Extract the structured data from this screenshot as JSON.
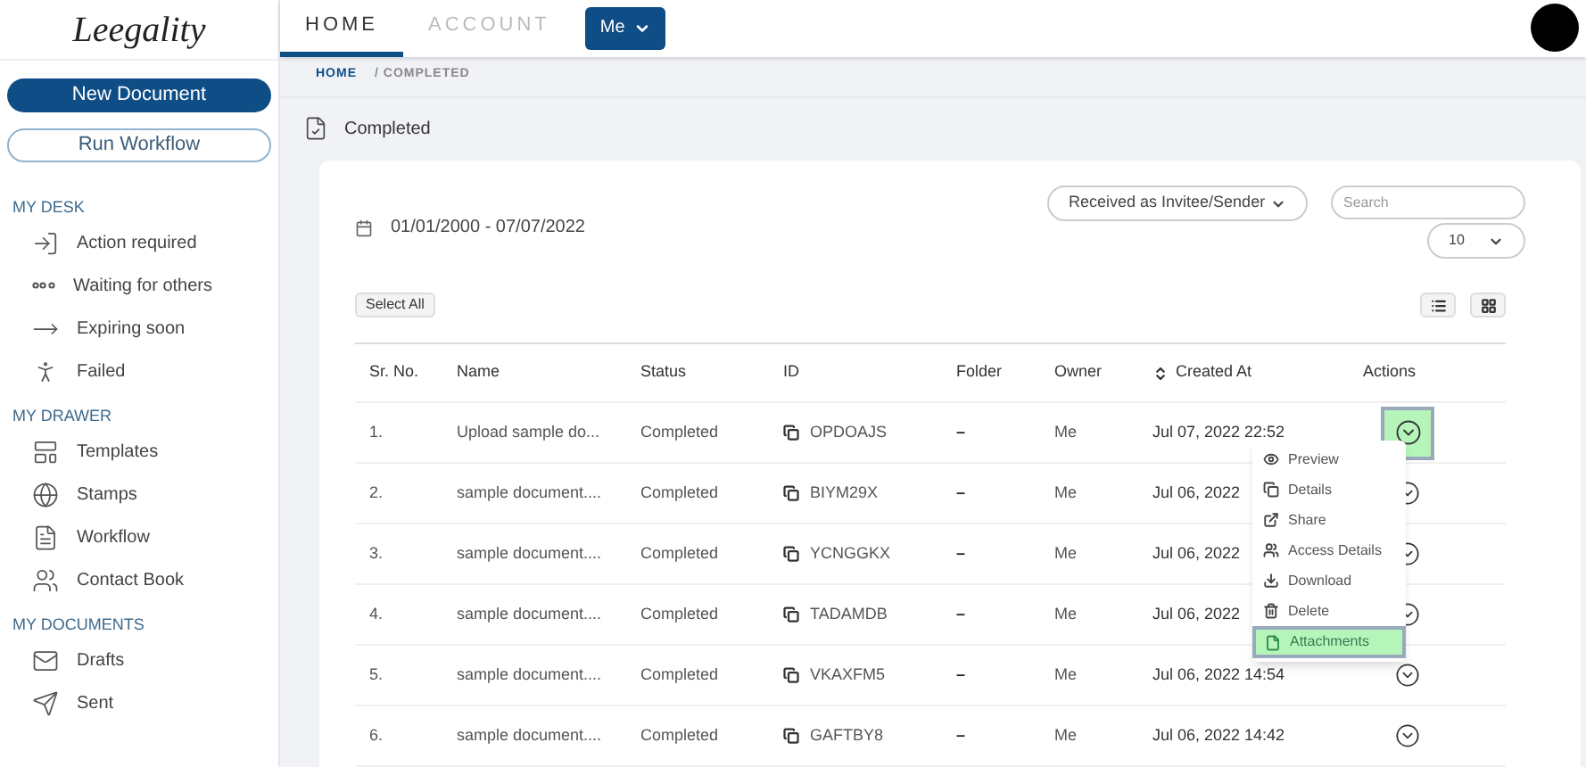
{
  "logo": {
    "text": "Leegality"
  },
  "sidebar": {
    "buttons": [
      {
        "label": "New Document",
        "kind": "primary"
      },
      {
        "label": "Run Workflow",
        "kind": "outline"
      }
    ],
    "sections": [
      {
        "title": "MY DESK",
        "items": [
          {
            "label": "Action required",
            "kind": "action"
          },
          {
            "label": "Waiting for others",
            "kind": "waiting"
          },
          {
            "label": "Expiring soon",
            "kind": "expiring"
          },
          {
            "label": "Failed",
            "kind": "failed"
          }
        ]
      },
      {
        "title": "MY DRAWER",
        "items": [
          {
            "label": "Templates",
            "kind": "templates"
          },
          {
            "label": "Stamps",
            "kind": "stamps"
          },
          {
            "label": "Workflow",
            "kind": "workflow"
          },
          {
            "label": "Contact Book",
            "kind": "contacts"
          }
        ]
      },
      {
        "title": "MY DOCUMENTS",
        "items": [
          {
            "label": "Drafts",
            "kind": "drafts"
          },
          {
            "label": "Sent",
            "kind": "sent"
          }
        ]
      }
    ]
  },
  "tabs": [
    {
      "label": "HOME",
      "selected": true
    },
    {
      "label": "ACCOUNT",
      "selected": false
    }
  ],
  "user_menu": {
    "label": "Me"
  },
  "breadcrumb": [
    {
      "label": "HOME",
      "selected": false
    },
    {
      "label": "/ COMPLETED",
      "selected": true
    }
  ],
  "page_title": "Completed",
  "filters": {
    "date_range": "01/01/2000 - 07/07/2022",
    "view_select": "Received as Invitee/Sender",
    "search": {
      "placeholder": "Search"
    },
    "page_size": "10",
    "select_all": "Select All"
  },
  "table": {
    "columns": [
      "Sr. No.",
      "Name",
      "Status",
      "ID",
      "Folder",
      "Owner",
      "Created At",
      "Actions"
    ],
    "rows": [
      {
        "sr": "1.",
        "name": "Upload sample do...",
        "status": "Completed",
        "id": "OPDOAJS",
        "folder": "–",
        "owner": "Me",
        "created": "Jul 07, 2022 22:52",
        "selected": true
      },
      {
        "sr": "2.",
        "name": "sample document....",
        "status": "Completed",
        "id": "BIYM29X",
        "folder": "–",
        "owner": "Me",
        "created": "Jul 06, 2022",
        "selected": false
      },
      {
        "sr": "3.",
        "name": "sample document....",
        "status": "Completed",
        "id": "YCNGGKX",
        "folder": "–",
        "owner": "Me",
        "created": "Jul 06, 2022",
        "selected": false
      },
      {
        "sr": "4.",
        "name": "sample document....",
        "status": "Completed",
        "id": "TADAMDB",
        "folder": "–",
        "owner": "Me",
        "created": "Jul 06, 2022",
        "selected": false
      },
      {
        "sr": "5.",
        "name": "sample document....",
        "status": "Completed",
        "id": "VKAXFM5",
        "folder": "–",
        "owner": "Me",
        "created": "Jul 06, 2022 14:54",
        "selected": false
      },
      {
        "sr": "6.",
        "name": "sample document....",
        "status": "Completed",
        "id": "GAFTBY8",
        "folder": "–",
        "owner": "Me",
        "created": "Jul 06, 2022 14:42",
        "selected": false
      }
    ]
  },
  "action_menu": [
    {
      "label": "Preview",
      "kind": "preview",
      "selected": false
    },
    {
      "label": "Details",
      "kind": "details",
      "selected": false
    },
    {
      "label": "Share",
      "kind": "share",
      "selected": false
    },
    {
      "label": "Access Details",
      "kind": "access",
      "selected": false
    },
    {
      "label": "Download",
      "kind": "download",
      "selected": false
    },
    {
      "label": "Delete",
      "kind": "delete",
      "selected": false
    },
    {
      "label": "Attachments",
      "kind": "attachments",
      "selected": true
    }
  ]
}
